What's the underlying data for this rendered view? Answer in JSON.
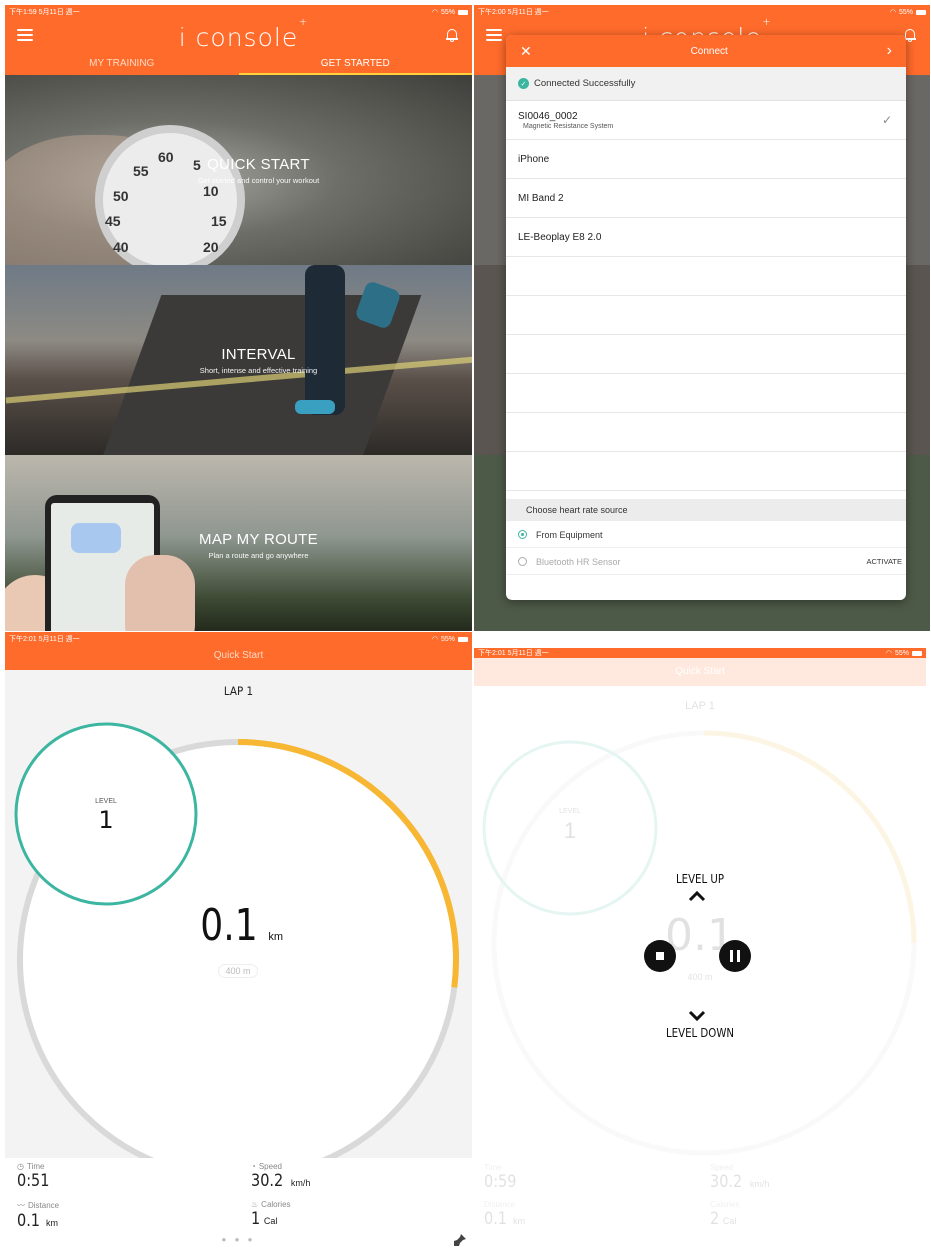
{
  "panel1": {
    "status": {
      "time": "下午1:59 5月11日 週一",
      "battery": "55%"
    },
    "app_title": "i console",
    "tabs": [
      {
        "label": "MY TRAINING"
      },
      {
        "label": "GET STARTED"
      }
    ],
    "tiles": [
      {
        "title": "QUICK START",
        "subtitle": "Get started and control your workout"
      },
      {
        "title": "INTERVAL",
        "subtitle": "Short, intense and effective training"
      },
      {
        "title": "MAP MY ROUTE",
        "subtitle": "Plan a route and go anywhere"
      }
    ],
    "stopwatch_numbers": [
      "55",
      "60",
      "5",
      "50",
      "10",
      "45",
      "15",
      "40",
      "20"
    ]
  },
  "panel2": {
    "status": {
      "time": "下午2:00 5月11日 週一",
      "battery": "55%"
    },
    "app_title": "i console",
    "modal_title": "Connect",
    "connected_text": "Connected Successfully",
    "devices": [
      {
        "name": "SI0046_0002",
        "sub": "Magnetic Resistance System",
        "checked": true
      },
      {
        "name": "iPhone",
        "sub": "",
        "checked": false
      },
      {
        "name": "MI Band 2",
        "sub": "",
        "checked": false
      },
      {
        "name": "LE-Beoplay E8 2.0",
        "sub": "",
        "checked": false
      }
    ],
    "hr_header": "Choose heart rate source",
    "hr_options": [
      {
        "label": "From Equipment",
        "selected": true
      },
      {
        "label": "Bluetooth HR Sensor",
        "selected": false
      }
    ],
    "activate_label": "ACTIVATE"
  },
  "panel3": {
    "status": {
      "time": "下午2:01 5月11日 週一",
      "battery": "55%"
    },
    "title": "Quick Start",
    "lap": "LAP 1",
    "level_label": "LEVEL",
    "level_value": "1",
    "distance_value": "0.1",
    "distance_unit": "km",
    "lap_length": "400 m",
    "lap_progress": 0.27,
    "stats": [
      {
        "label": "Time",
        "value": "0:51",
        "unit": ""
      },
      {
        "label": "Speed",
        "value": "30.2",
        "unit": "km/h"
      },
      {
        "label": "Distance",
        "value": "0.1",
        "unit": "km"
      },
      {
        "label": "Calories",
        "value": "1",
        "unit": "Cal"
      }
    ],
    "pager": "● ● ●"
  },
  "panel4": {
    "status": {
      "time": "下午2:01 5月11日 週一",
      "battery": "55%"
    },
    "title": "Quick Start",
    "lap": "LAP 1",
    "level_label": "LEVEL",
    "level_value": "1",
    "distance_value": "0.1",
    "lap_length": "400 m",
    "level_up": "LEVEL UP",
    "level_down": "LEVEL DOWN",
    "stats": [
      {
        "label": "Time",
        "value": "0:59",
        "unit": ""
      },
      {
        "label": "Speed",
        "value": "30.2",
        "unit": "km/h"
      },
      {
        "label": "Distance",
        "value": "0.1",
        "unit": "km"
      },
      {
        "label": "Calories",
        "value": "2",
        "unit": "Cal"
      }
    ]
  },
  "colors": {
    "accent": "#ff6b2b",
    "teal": "#3cb6a0",
    "progress": "#f7b733",
    "tab_underline": "#ffd23c"
  }
}
